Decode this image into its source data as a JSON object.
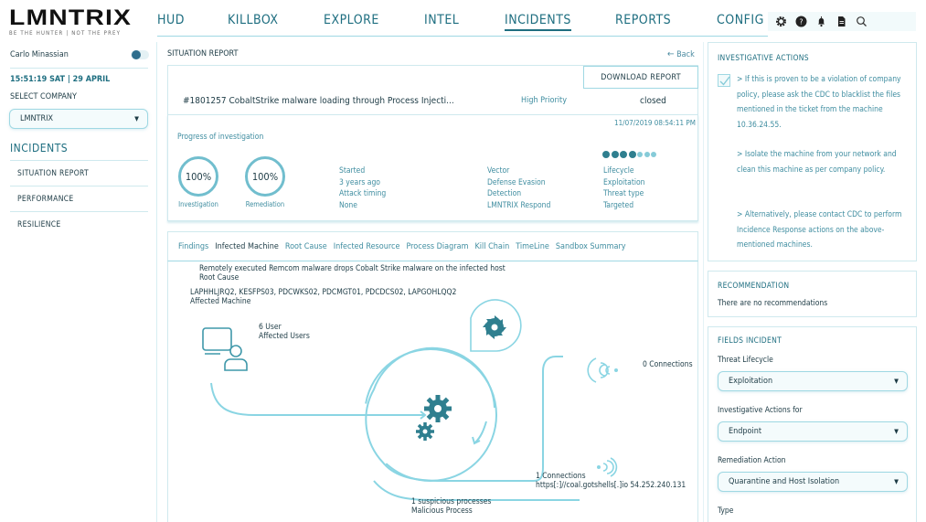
{
  "brand": {
    "logo": "LMNTRIX",
    "tagline": "BE THE HUNTER  |  NOT THE PREY"
  },
  "nav": {
    "items": [
      {
        "label": "HUD",
        "active": false
      },
      {
        "label": "KILLBOX",
        "active": false
      },
      {
        "label": "EXPLORE",
        "active": false
      },
      {
        "label": "INTEL",
        "active": false
      },
      {
        "label": "INCIDENTS",
        "active": true
      },
      {
        "label": "REPORTS",
        "active": false
      },
      {
        "label": "CONFIG",
        "active": false
      }
    ],
    "toolbar_icons": [
      "settings-icon",
      "help-icon",
      "bell-icon",
      "document-icon",
      "search-icon"
    ]
  },
  "sidebar": {
    "user_name": "Carlo Minassian",
    "clock": "15:51:19  SAT  |  29 APRIL",
    "select_company_label": "SELECT COMPANY",
    "company_selected": "LMNTRIX",
    "section_title": "INCIDENTS",
    "items": [
      {
        "label": "SITUATION REPORT"
      },
      {
        "label": "PERFORMANCE"
      },
      {
        "label": "RESILIENCE"
      }
    ]
  },
  "report": {
    "title": "SITUATION REPORT",
    "back_label": "Back",
    "download_label": "DOWNLOAD REPORT",
    "incident_title": "#1801257 CobaltStrike malware loading through Process Injecti...",
    "priority": "High Priority",
    "status": "closed",
    "timestamp": "11/07/2019 08:54:11 PM",
    "progress_label": "Progress of investigation",
    "investigation": {
      "value": "100%",
      "label": "Investigation",
      "percent": 100
    },
    "remediation": {
      "value": "100%",
      "label": "Remediation",
      "percent": 100
    },
    "col1": [
      "Started",
      "3 years ago",
      "Attack timing",
      "None"
    ],
    "col2": [
      "Vector",
      "Defense Evasion",
      "Detection",
      "LMNTRIX Respond"
    ],
    "col3": [
      "Lifecycle",
      "Exploitation",
      "Threat type",
      "Targeted"
    ],
    "lifecycle_steps": {
      "completed": 4,
      "total": 7
    },
    "colors": {
      "dot_done": "#2f7f8f",
      "dot_todo": "#86cbd8",
      "accent": "#71bece"
    }
  },
  "tabs": [
    {
      "label": "Findings",
      "active": false
    },
    {
      "label": "Infected Machine",
      "active": true
    },
    {
      "label": "Root Cause",
      "active": false
    },
    {
      "label": "Infected Resource",
      "active": false
    },
    {
      "label": "Process Diagram",
      "active": false
    },
    {
      "label": "Kill Chain",
      "active": false
    },
    {
      "label": "TimeLine",
      "active": false
    },
    {
      "label": "Sandbox Summary",
      "active": false
    }
  ],
  "diagram": {
    "root_cause_text": "Remotely executed Remcom malware drops Cobalt Strike malware on the infected host",
    "root_cause_label": "Root Cause",
    "machines_text": "LAPHHLJRQ2, KESFPS03, PDCWKS02, PDCMGT01, PDCDCS02, LAPGOHLQQ2",
    "machines_label": "Affected Machine",
    "users_value": "6 User",
    "users_label": "Affected Users",
    "conn0": "0 Connections",
    "conn1": "1 Connections",
    "conn1_detail": "https[:]//coal.gotshells[.]io 54.252.240.131",
    "proc_value": "1 suspicious processes",
    "proc_label": "Malicious Process"
  },
  "investigative_actions": {
    "title": "INVESTIGATIVE ACTIONS",
    "checked": true,
    "paragraphs": [
      "> If this is proven to be a violation of company policy, please ask the CDC to blacklist the files mentioned in the ticket from the machine 10.36.24.55.",
      "> Isolate the machine from your network and clean this machine as per company policy.",
      "> Alternatively, please contact CDC to perform Incidence Response actions on the above-mentioned machines."
    ]
  },
  "recommendation": {
    "title": "RECOMMENDATION",
    "text": "There are no recommendations"
  },
  "fields_incident": {
    "title": "FIELDS INCIDENT",
    "fields": [
      {
        "label": "Threat Lifecycle",
        "value": "Exploitation"
      },
      {
        "label": "Investigative Actions for",
        "value": "Endpoint"
      },
      {
        "label": "Remediation Action",
        "value": "Quarantine and Host Isolation"
      }
    ],
    "next_label": "Type"
  }
}
